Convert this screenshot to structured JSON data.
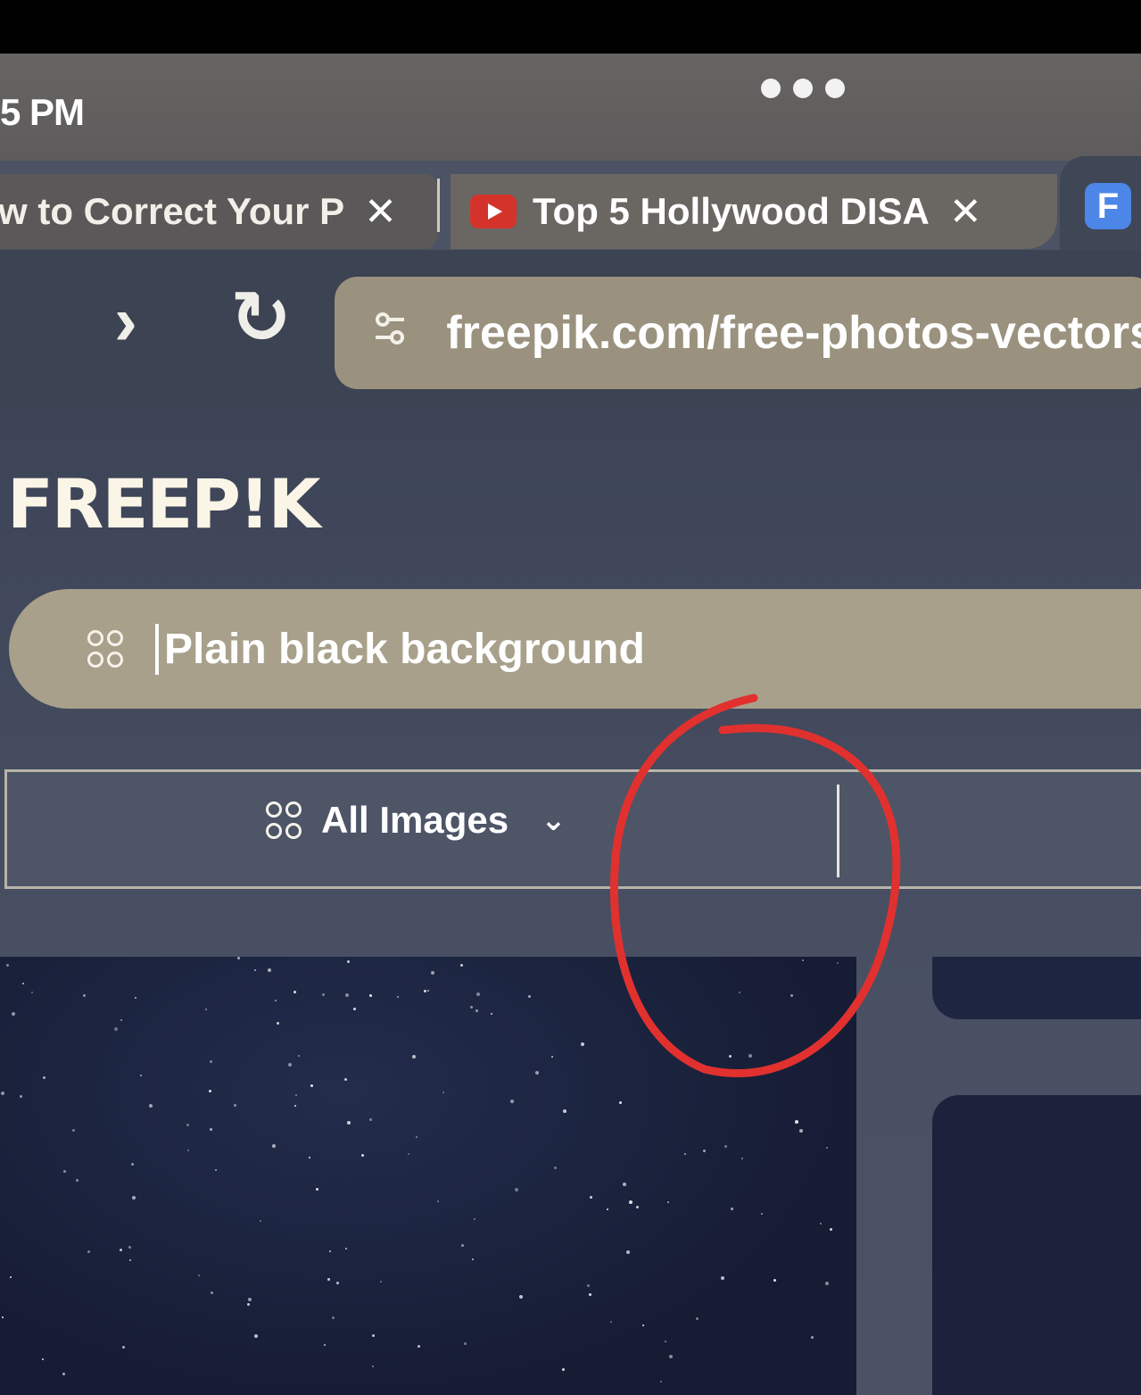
{
  "status": {
    "clock": "5 PM"
  },
  "tabs": [
    {
      "title": "w to Correct Your P",
      "close": "✕"
    },
    {
      "title": "Top 5 Hollywood DISA",
      "close": "✕"
    },
    {
      "favicon_letter": "F"
    }
  ],
  "nav": {
    "back": "‹",
    "forward": "›",
    "reload": "↻",
    "url": "freepik.com/free-photos-vectors"
  },
  "site": {
    "logo": "FREEP!K",
    "search": {
      "value": "Plain black background"
    },
    "filter": {
      "label": "All Images",
      "chevron": "⌄"
    }
  },
  "colors": {
    "accent_red": "#e0312f",
    "youtube_red": "#d4332c",
    "favicon_blue": "#4c86e6"
  },
  "icons": {
    "tune": "tune-icon",
    "grid": "grid-icon"
  }
}
